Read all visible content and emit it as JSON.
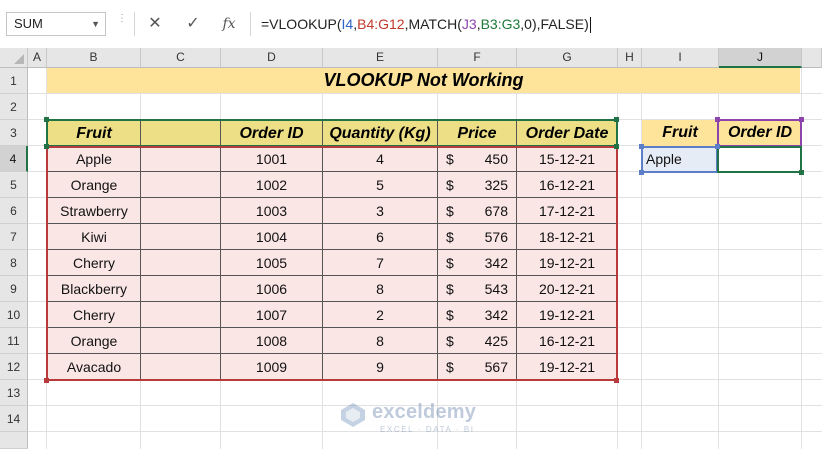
{
  "name_box": {
    "value": "SUM",
    "dropdown_glyph": "▼"
  },
  "formula_bar": {
    "cancel_glyph": "✕",
    "enter_glyph": "✓",
    "fx_glyph": "fx",
    "segments": [
      "=VLOOKUP(",
      "I4",
      ",",
      "B4:G12",
      ",MATCH(",
      "J3",
      ",",
      "B3:G3",
      ",0),FALSE)"
    ]
  },
  "columns": [
    "A",
    "B",
    "C",
    "D",
    "E",
    "F",
    "G",
    "H",
    "I",
    "J"
  ],
  "rows": [
    "1",
    "2",
    "3",
    "4",
    "5",
    "6",
    "7",
    "8",
    "9",
    "10",
    "11",
    "12",
    "13",
    "14"
  ],
  "title": "VLOOKUP Not Working",
  "table": {
    "headers": [
      "Fruit",
      "",
      "Order ID",
      "Quantity (Kg)",
      "Price",
      "Order Date"
    ],
    "currency": "$",
    "rows": [
      [
        "Apple",
        "",
        "1001",
        "4",
        "450",
        "15-12-21"
      ],
      [
        "Orange",
        "",
        "1002",
        "5",
        "325",
        "16-12-21"
      ],
      [
        "Strawberry",
        "",
        "1003",
        "3",
        "678",
        "17-12-21"
      ],
      [
        "Kiwi",
        "",
        "1004",
        "6",
        "576",
        "18-12-21"
      ],
      [
        "Cherry",
        "",
        "1005",
        "7",
        "342",
        "19-12-21"
      ],
      [
        "Blackberry",
        "",
        "1006",
        "8",
        "543",
        "20-12-21"
      ],
      [
        "Cherry",
        "",
        "1007",
        "2",
        "342",
        "19-12-21"
      ],
      [
        "Orange",
        "",
        "1008",
        "8",
        "425",
        "16-12-21"
      ],
      [
        "Avacado",
        "",
        "1009",
        "9",
        "567",
        "19-12-21"
      ]
    ]
  },
  "lookup": {
    "headers": [
      "Fruit",
      "Order ID"
    ],
    "fruit_value": "Apple",
    "order_id_value": ""
  },
  "watermark": {
    "name": "exceldemy",
    "tagline": "EXCEL · DATA · BI"
  },
  "colors": {
    "excel_green": "#217346",
    "title_fill": "#fde49a",
    "header_fill": "#ecdf86",
    "body_fill": "#fbe6e6"
  }
}
